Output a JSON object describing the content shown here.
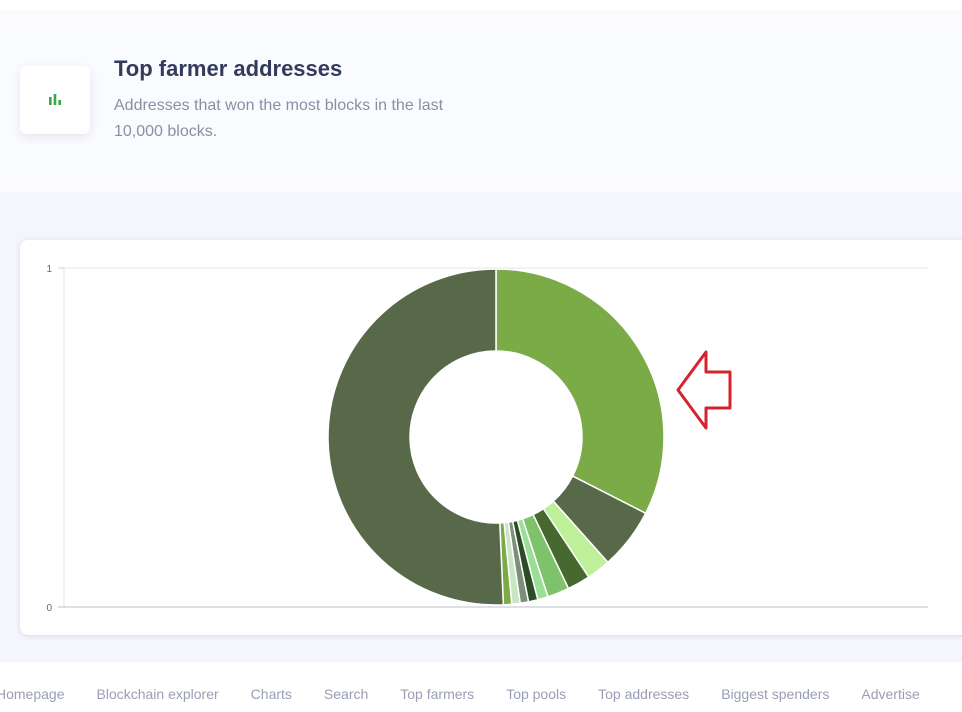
{
  "header": {
    "title": "Top farmer addresses",
    "subtitle": "Addresses that won the most blocks in the last 10,000 blocks.",
    "icon": "bar-chart-icon",
    "icon_color": "#3aa64a"
  },
  "chart_data": {
    "type": "pie",
    "variant": "doughnut",
    "y_ticks": [
      "1",
      "0"
    ],
    "ylim": [
      0,
      1
    ],
    "grid": true,
    "legend": "none",
    "annotation": "red outline arrow pointing left at the largest highlighted slice",
    "slices": [
      {
        "value": 32.5,
        "color": "#7aab46"
      },
      {
        "value": 5.9,
        "color": "#58694a"
      },
      {
        "value": 2.3,
        "color": "#bdf098"
      },
      {
        "value": 2.2,
        "color": "#47682e"
      },
      {
        "value": 2.1,
        "color": "#7ec26b"
      },
      {
        "value": 1.0,
        "color": "#99e096"
      },
      {
        "value": 0.9,
        "color": "#2c4d24"
      },
      {
        "value": 0.8,
        "color": "#7b8f7a"
      },
      {
        "value": 0.8,
        "color": "#c8e6c4"
      },
      {
        "value": 0.8,
        "color": "#7aab46"
      },
      {
        "value": 50.7,
        "color": "#58694a"
      }
    ]
  },
  "footer": {
    "links": [
      "Homepage",
      "Blockchain explorer",
      "Charts",
      "Search",
      "Top farmers",
      "Top pools",
      "Top addresses",
      "Biggest spenders",
      "Advertise"
    ]
  }
}
